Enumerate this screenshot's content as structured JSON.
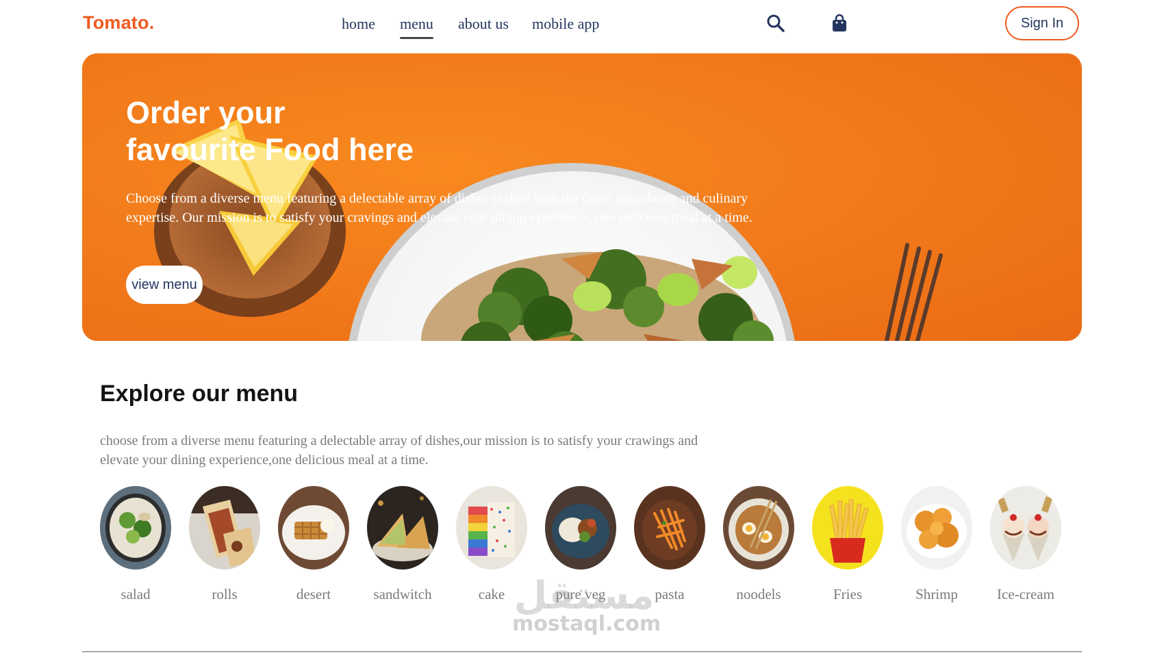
{
  "header": {
    "logo": "Tomato.",
    "nav": [
      {
        "label": "home",
        "active": false
      },
      {
        "label": "menu",
        "active": true
      },
      {
        "label": "about us",
        "active": false
      },
      {
        "label": "mobile app",
        "active": false
      }
    ],
    "search_icon": "search-icon",
    "basket_icon": "shopping-bag-icon",
    "signin_label": "Sign In"
  },
  "hero": {
    "title_line1": "Order your",
    "title_line2": "favourite Food here",
    "text": "Choose from a diverse menu featuring a delectable array of dishes crafted with the finest ingredients and culinary expertise. Our mission is to satisfy your cravings and elevate your dining experience, one delicious meal at a time.",
    "button_label": "view menu"
  },
  "explore": {
    "title": "Explore our menu",
    "text": "choose from a diverse menu featuring a delectable array of dishes,our mission is to satisfy your crawings and elevate your dining experience,one delicious meal at a time.",
    "items": [
      {
        "label": "salad"
      },
      {
        "label": "rolls"
      },
      {
        "label": "desert"
      },
      {
        "label": "sandwitch"
      },
      {
        "label": "cake"
      },
      {
        "label": "pure veg"
      },
      {
        "label": "pasta"
      },
      {
        "label": "noodels"
      },
      {
        "label": "Fries"
      },
      {
        "label": "Shrimp"
      },
      {
        "label": "Ice-cream"
      }
    ]
  },
  "watermark": {
    "arabic": "مستقل",
    "latin": "mostaql.com"
  },
  "colors": {
    "brand": "#f05a1e",
    "hero_bg": "#f0741c",
    "nav_text": "#23345e"
  }
}
